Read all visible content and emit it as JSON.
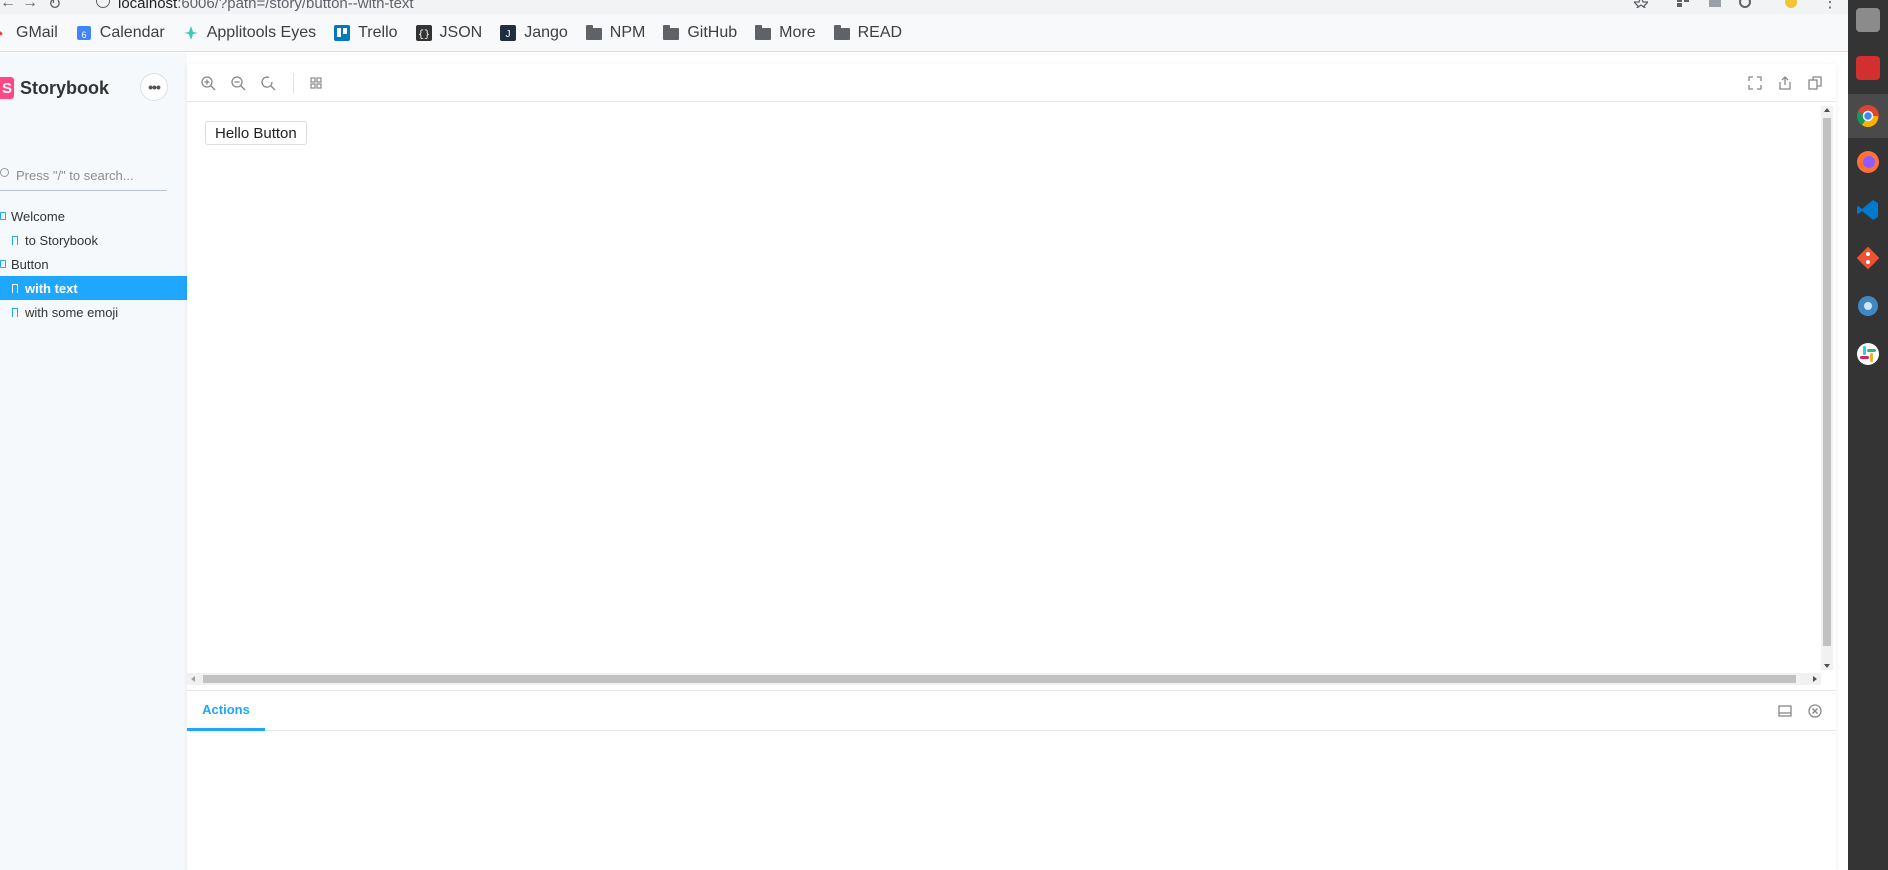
{
  "browser": {
    "url_host": "localhost",
    "url_rest": ":6006/?path=/story/button--with-text",
    "bookmarks": [
      {
        "label": "GMail",
        "icon": "gmail-icon"
      },
      {
        "label": "Calendar",
        "icon": "calendar-icon"
      },
      {
        "label": "Applitools Eyes",
        "icon": "applitools-icon"
      },
      {
        "label": "Trello",
        "icon": "trello-icon"
      },
      {
        "label": "JSON",
        "icon": "json-icon"
      },
      {
        "label": "Jango",
        "icon": "jango-icon"
      },
      {
        "label": "NPM",
        "icon": "folder-icon"
      },
      {
        "label": "GitHub",
        "icon": "folder-icon"
      },
      {
        "label": "More",
        "icon": "folder-icon"
      },
      {
        "label": "READ",
        "icon": "folder-icon"
      }
    ]
  },
  "sidebar": {
    "brand": "Storybook",
    "brand_logo_letter": "S",
    "menu_label": "•••",
    "search_placeholder": "Press \"/\" to search...",
    "tree": [
      {
        "label": "Welcome",
        "kind": "group"
      },
      {
        "label": "to Storybook",
        "kind": "leaf"
      },
      {
        "label": "Button",
        "kind": "group"
      },
      {
        "label": "with text",
        "kind": "leaf",
        "selected": true
      },
      {
        "label": "with some emoji",
        "kind": "leaf"
      }
    ]
  },
  "preview": {
    "button_label": "Hello Button"
  },
  "addons": {
    "active_tab": "Actions"
  },
  "colors": {
    "accent": "#1ea7fd",
    "brand": "#ff4785"
  }
}
